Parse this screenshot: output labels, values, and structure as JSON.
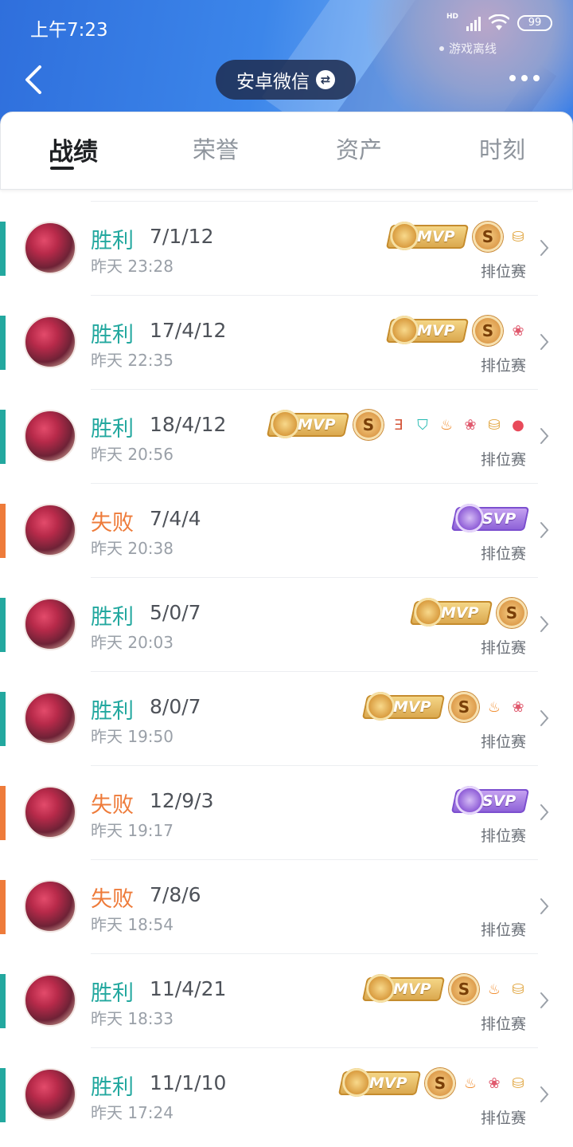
{
  "status": {
    "time": "上午7:23",
    "hd": "HD",
    "battery": "99",
    "offline": "游戏离线"
  },
  "header": {
    "account": "安卓微信",
    "swap_glyph": "⇄"
  },
  "tabs": [
    {
      "label": "战绩"
    },
    {
      "label": "荣誉"
    },
    {
      "label": "资产"
    },
    {
      "label": "时刻"
    }
  ],
  "mvp_text": "MVP",
  "svp_text": "SVP",
  "s_text": "S",
  "colors": {
    "win": "#23a89f",
    "lose": "#ee7b3a",
    "header_blue": "#3c86ea",
    "mvp_gold": "#d9a54b",
    "svp_purple": "#8a5ed6"
  },
  "matches": [
    {
      "result": "胜利",
      "kda": "7/1/12",
      "time": "昨天 23:28",
      "mode": "排位赛",
      "outcome": "win",
      "badges": [
        "mvp",
        "s-coin",
        "coins-icon"
      ]
    },
    {
      "result": "胜利",
      "kda": "17/4/12",
      "time": "昨天 22:35",
      "mode": "排位赛",
      "outcome": "win",
      "badges": [
        "mvp",
        "s-coin",
        "flower-icon"
      ]
    },
    {
      "result": "胜利",
      "kda": "18/4/12",
      "time": "昨天 20:56",
      "mode": "排位赛",
      "outcome": "win",
      "badges": [
        "mvp",
        "s-coin",
        "triple-kill-icon",
        "shield-icon",
        "fire-icon",
        "flower-icon",
        "coins-icon",
        "blood-drop-icon"
      ]
    },
    {
      "result": "失败",
      "kda": "7/4/4",
      "time": "昨天 20:38",
      "mode": "排位赛",
      "outcome": "lose",
      "badges": [
        "svp"
      ]
    },
    {
      "result": "胜利",
      "kda": "5/0/7",
      "time": "昨天 20:03",
      "mode": "排位赛",
      "outcome": "win",
      "badges": [
        "mvp",
        "s-coin"
      ]
    },
    {
      "result": "胜利",
      "kda": "8/0/7",
      "time": "昨天 19:50",
      "mode": "排位赛",
      "outcome": "win",
      "badges": [
        "mvp",
        "s-coin",
        "fire-icon",
        "flower-icon"
      ]
    },
    {
      "result": "失败",
      "kda": "12/9/3",
      "time": "昨天 19:17",
      "mode": "排位赛",
      "outcome": "lose",
      "badges": [
        "svp"
      ]
    },
    {
      "result": "失败",
      "kda": "7/8/6",
      "time": "昨天 18:54",
      "mode": "排位赛",
      "outcome": "lose",
      "badges": []
    },
    {
      "result": "胜利",
      "kda": "11/4/21",
      "time": "昨天 18:33",
      "mode": "排位赛",
      "outcome": "win",
      "badges": [
        "mvp",
        "s-coin",
        "fire-icon",
        "coins-icon"
      ]
    },
    {
      "result": "胜利",
      "kda": "11/1/10",
      "time": "昨天 17:24",
      "mode": "排位赛",
      "outcome": "win",
      "badges": [
        "mvp",
        "s-coin",
        "fire-icon",
        "flower-icon",
        "coins-icon"
      ]
    }
  ]
}
